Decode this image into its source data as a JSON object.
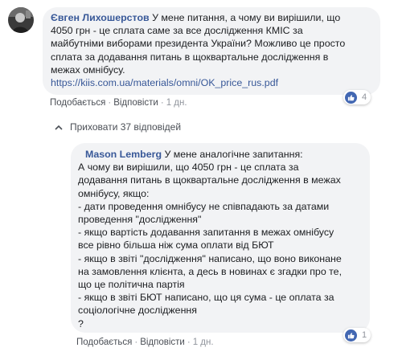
{
  "comment1": {
    "author": "Євген Лихошерстов",
    "text_lines": [
      " У мене питання, а чому ви вирішили, що",
      "4050 грн - це сплата саме за все дослідження КМІС за",
      "майбутніми виборами президента України? Можливо це просто",
      "сплата за додавання питань в щоквартальне дослідження в",
      "межах омнібусу."
    ],
    "link": "https://kiis.com.ua/materials/omni/OK_price_rus.pdf",
    "actions": {
      "like": "Подобається",
      "reply": "Відповісти",
      "time": "1 дн."
    },
    "reactions": {
      "icon": "like-icon",
      "count": "4"
    }
  },
  "replies_toggle": {
    "icon": "chevron-up-icon",
    "label": "Приховати 37 відповідей"
  },
  "comment2": {
    "author": "Mason Lemberg",
    "first_line": " У мене аналогічне запитання:",
    "text_lines": [
      "А чому ви вирішили, що 4050 грн - це сплата за",
      "додавання питань в щоквартальне дослідження в межах",
      "омнібусу, якщо:",
      "- дати проведення омнібусу не співпадають за датами",
      "проведення \"дослідження\"",
      "- якщо вартість додавання запитання в межах омнібусу",
      "все рівно більша ніж сума оплати від БЮТ",
      "- якщо в звіті \"дослідження\" написано, що воно виконане",
      "на замовлення клієнта, а десь в новинах є згадки про те,",
      "що це політична партія",
      "- якщо в звіті БЮТ написано, що ця сума - це оплата за",
      "соціологічне дослідження",
      "?"
    ],
    "actions": {
      "like": "Подобається",
      "reply": "Відповісти",
      "time": "1 дн."
    },
    "reactions": {
      "icon": "like-icon",
      "count": "1"
    }
  },
  "colors": {
    "author": "#385898",
    "bubble": "#f2f3f5",
    "like_blue": "#4267b2",
    "meta": "#90949c"
  }
}
